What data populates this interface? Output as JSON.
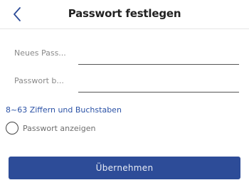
{
  "header": {
    "title": "Passwort festlegen",
    "back_icon": "chevron-left-icon"
  },
  "form": {
    "new_password": {
      "label": "Neues Pass...",
      "value": ""
    },
    "confirm_password": {
      "label": "Passwort b...",
      "value": ""
    },
    "hint": "8~63 Ziffern und Buchstaben",
    "show_password": {
      "label": "Passwort anzeigen",
      "checked": false
    },
    "submit_label": "Übernehmen"
  },
  "colors": {
    "accent": "#2d4c98",
    "hint": "#2b52a6",
    "label": "#8a8a8a"
  }
}
